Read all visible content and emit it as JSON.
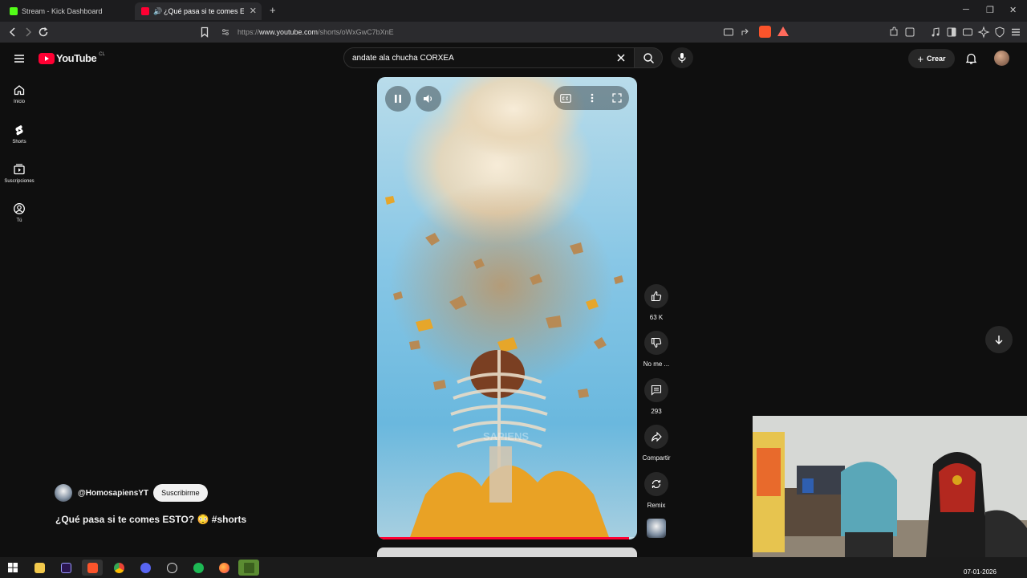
{
  "browser": {
    "tabs": [
      {
        "title": "Stream - Kick Dashboard",
        "favicon_color": "#53fc18"
      },
      {
        "title": "¿Qué pasa si te comes ESTO?",
        "favicon_color": "#ff0033",
        "active": true
      }
    ],
    "url_prefix": "https://",
    "url_host": "www.youtube.com",
    "url_path": "/shorts/oWxGwC7bXnE"
  },
  "youtube": {
    "logo_text": "YouTube",
    "country_code": "CL",
    "search": {
      "value": "andate ala chucha CORXEA"
    },
    "create_label": "Crear",
    "guide": [
      {
        "label": "Inicio",
        "icon": "home-icon"
      },
      {
        "label": "Shorts",
        "icon": "shorts-icon"
      },
      {
        "label": "Suscripciones",
        "icon": "subscriptions-icon"
      },
      {
        "label": "Tú",
        "icon": "you-icon"
      }
    ],
    "actions": {
      "like_count": "63 K",
      "dislike_label": "No me ...",
      "comments_count": "293",
      "share_label": "Compartir",
      "remix_label": "Remix"
    },
    "channel": {
      "handle": "@HomosapiensYT",
      "subscribe_label": "Suscribirme"
    },
    "video_title": "¿Qué pasa si te comes ESTO? 😳 #shorts",
    "watermark": "SAPIENS",
    "progress_fraction": 0.97
  },
  "taskbar": {
    "date": "07-01-2026",
    "apps": [
      "windows-start",
      "file-explorer",
      "premiere-pro",
      "brave",
      "chrome",
      "discord",
      "obs-studio",
      "spotify",
      "firefox",
      "minecraft"
    ]
  },
  "colors": {
    "accent": "#ff0033",
    "background": "#0f0f0f",
    "kick": "#53fc18"
  }
}
